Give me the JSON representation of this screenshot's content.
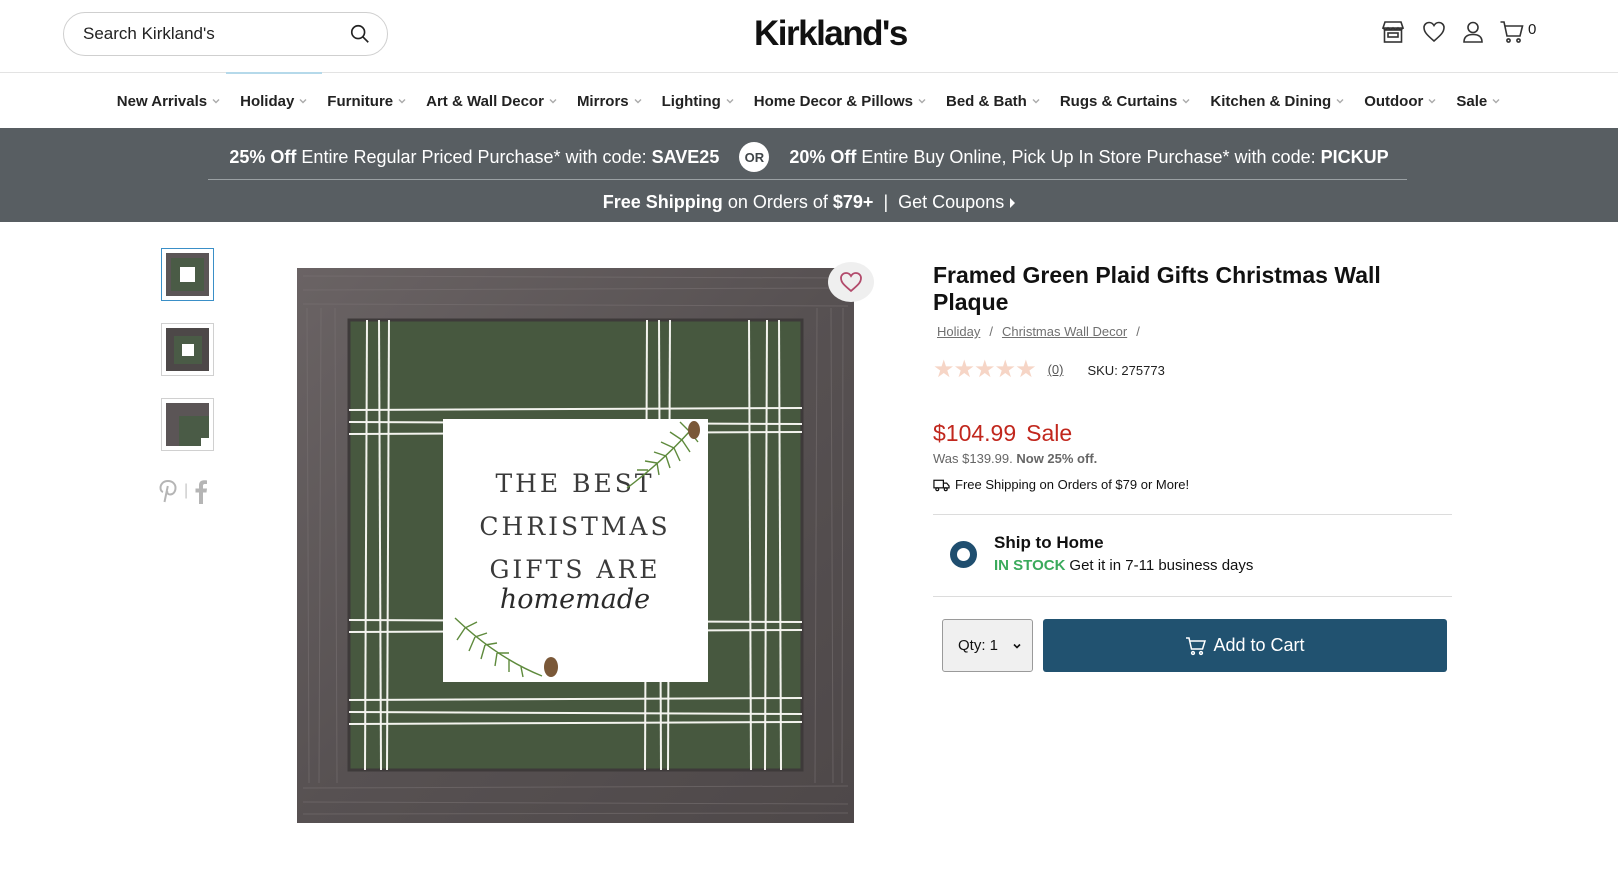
{
  "header": {
    "search_placeholder": "Search Kirkland's",
    "logo": "Kirkland's",
    "cart_count": "0"
  },
  "nav": {
    "items": [
      {
        "label": "New Arrivals"
      },
      {
        "label": "Holiday"
      },
      {
        "label": "Furniture"
      },
      {
        "label": "Art & Wall Decor"
      },
      {
        "label": "Mirrors"
      },
      {
        "label": "Lighting"
      },
      {
        "label": "Home Decor & Pillows"
      },
      {
        "label": "Bed & Bath"
      },
      {
        "label": "Rugs & Curtains"
      },
      {
        "label": "Kitchen & Dining"
      },
      {
        "label": "Outdoor"
      },
      {
        "label": "Sale"
      }
    ]
  },
  "promo": {
    "offer1_bold": "25% Off",
    "offer1_text": "Entire Regular Priced Purchase* with code:",
    "offer1_code": "SAVE25",
    "or": "OR",
    "offer2_bold": "20% Off",
    "offer2_text": "Entire Buy Online, Pick Up In Store Purchase* with code:",
    "offer2_code": "PICKUP",
    "shipping_bold": "Free Shipping",
    "shipping_text": "on Orders of",
    "shipping_amount": "$79+",
    "divider": "|",
    "coupons": "Get Coupons"
  },
  "image": {
    "line1": "THE BEST",
    "line2": "CHRISTMAS",
    "line3": "GIFTS ARE",
    "line4": "homemade"
  },
  "product": {
    "title": "Framed Green Plaid Gifts Christmas Wall Plaque",
    "breadcrumbs": [
      "Holiday",
      "Christmas Wall Decor"
    ],
    "crumb_sep": "/",
    "rating_stars": "★★★★★",
    "review_count": "(0)",
    "sku": "SKU: 275773",
    "price": "$104.99",
    "sale_label": "Sale",
    "was_price": "Was $139.99.",
    "savings": "Now 25% off.",
    "shipping_note": "Free Shipping on Orders of $79 or More!"
  },
  "fulfillment": {
    "title": "Ship to Home",
    "stock_status": "IN STOCK",
    "delivery": "Get it in 7-11 business days"
  },
  "purchase": {
    "qty_label": "Qty: 1",
    "add_to_cart": "Add to Cart"
  },
  "colors": {
    "promo_bg": "#585e62",
    "price_red": "#c1271d",
    "cart_button": "#215270",
    "in_stock_green": "#3aaa5c"
  }
}
